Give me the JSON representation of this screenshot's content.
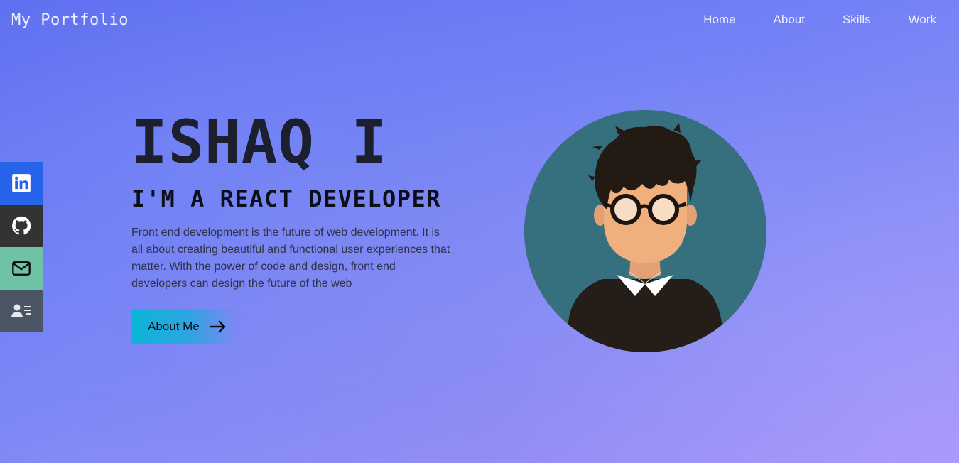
{
  "header": {
    "brand": "My Portfolio",
    "nav": [
      "Home",
      "About",
      "Skills",
      "Work"
    ]
  },
  "social": {
    "items": [
      {
        "icon": "linkedin-icon",
        "color": "#2563eb"
      },
      {
        "icon": "github-icon",
        "color": "#333333"
      },
      {
        "icon": "mail-icon",
        "color": "#6fc2a6"
      },
      {
        "icon": "contact-card-icon",
        "color": "#4b5563"
      }
    ]
  },
  "hero": {
    "name": "ISHAQ I",
    "role": "I'M A REACT DEVELOPER",
    "description": "Front end development is the future of web development. It is all about creating beautiful and functional user experiences that matter. With the power of code and design, front end developers can design the future of the web",
    "cta_label": "About Me"
  },
  "theme": {
    "gradient_start": "#5b6cf0",
    "gradient_end": "#a997fa",
    "avatar_bg": "#36707e"
  }
}
